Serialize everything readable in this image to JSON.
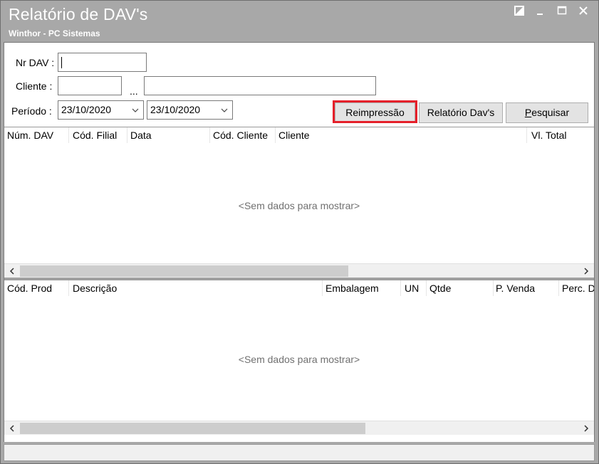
{
  "window": {
    "title": "Relatório de DAV's",
    "subtitle": "Winthor - PC Sistemas",
    "controls": [
      "restore-icon",
      "minimize-icon",
      "maximize-icon",
      "close-icon"
    ]
  },
  "filters": {
    "nr_dav_label": "Nr DAV :",
    "nr_dav_value": "",
    "cliente_label": "Cliente :",
    "cliente_code_value": "",
    "cliente_ellipsis": "...",
    "cliente_name_value": "",
    "periodo_label": "Período :",
    "periodo_start": "23/10/2020",
    "periodo_end": "23/10/2020"
  },
  "buttons": {
    "reimpressao": "Reimpressão",
    "relatorio_davs": "Relatório Dav's",
    "pesquisar": "Pesquisar",
    "pesquisar_accel": "P",
    "pesquisar_rest": "esquisar"
  },
  "grid_davs": {
    "columns": [
      "Núm. DAV",
      "Cód. Filial",
      "Data",
      "Cód. Cliente",
      "Cliente",
      "Vl. Total"
    ],
    "empty_text": "<Sem dados para mostrar>"
  },
  "grid_itens": {
    "columns": [
      "Cód. Prod",
      "Descrição",
      "Embalagem",
      "UN",
      "Qtde",
      "P. Venda",
      "Perc. D"
    ],
    "empty_text": "<Sem dados para mostrar>"
  },
  "colors": {
    "titlebar": "#a8a8a8",
    "highlight": "#e5202a",
    "button": "#e3e3e3"
  }
}
